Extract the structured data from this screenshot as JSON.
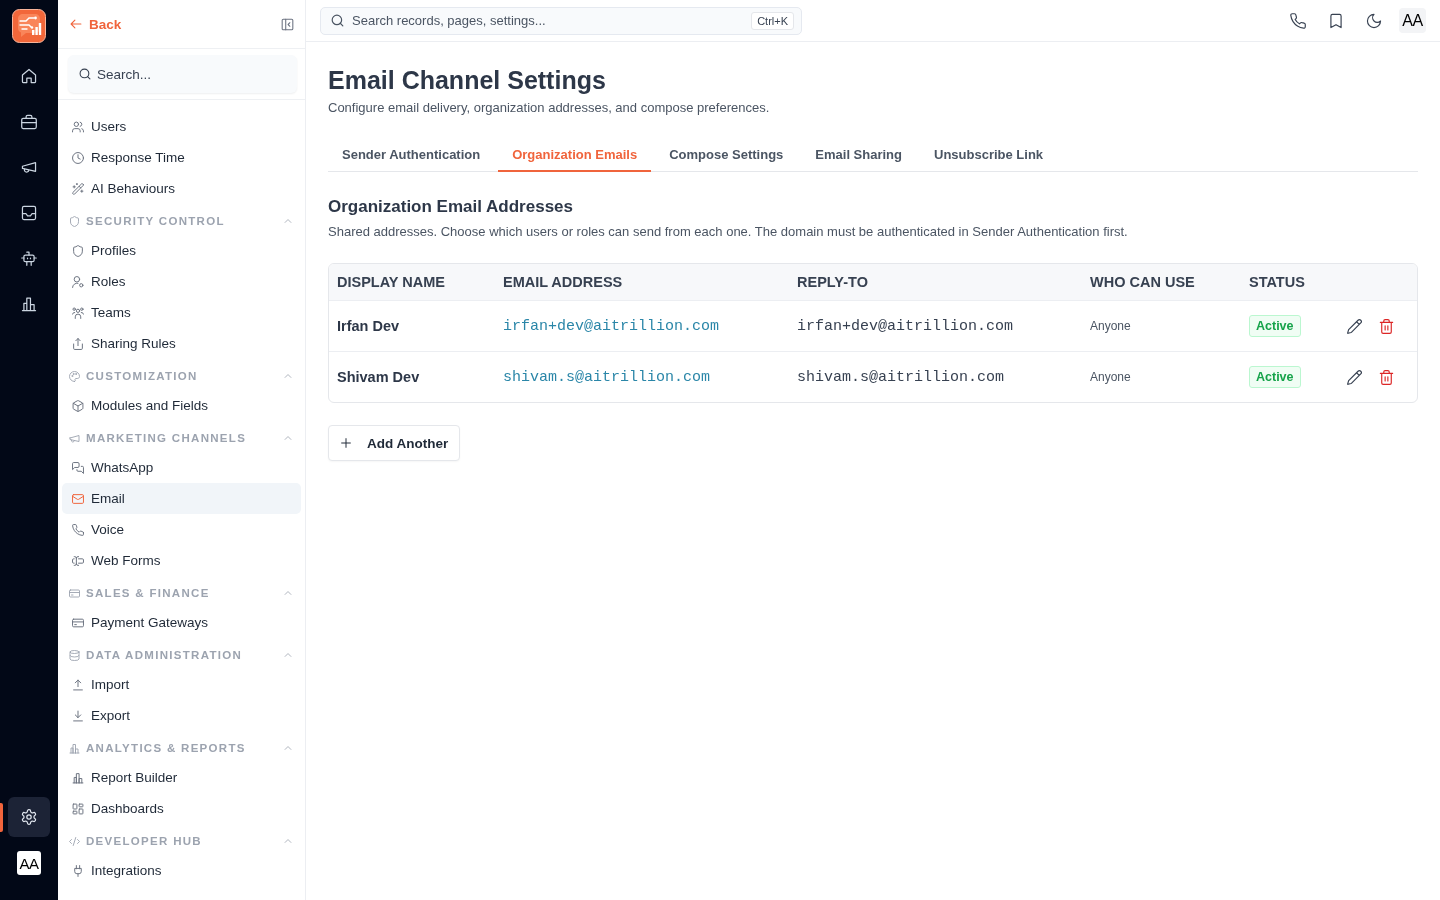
{
  "rail": {
    "nav_items": [
      {
        "selected": false
      },
      {
        "selected": false
      },
      {
        "selected": false
      },
      {
        "selected": false
      },
      {
        "selected": false
      },
      {
        "selected": false
      }
    ],
    "bottom_items": [
      {
        "selected": true
      }
    ],
    "avatar": "AA"
  },
  "sidebar": {
    "back_label": "Back",
    "search": {
      "placeholder": "Search..."
    },
    "items": [
      {
        "label": "Users",
        "selected": false
      },
      {
        "label": "Response Time",
        "selected": false
      },
      {
        "label": "AI Behaviours",
        "selected": false
      }
    ],
    "sections": [
      {
        "title": "SECURITY CONTROL",
        "expanded": true,
        "items": [
          {
            "label": "Profiles",
            "selected": false
          },
          {
            "label": "Roles",
            "selected": false
          },
          {
            "label": "Teams",
            "selected": false
          },
          {
            "label": "Sharing Rules",
            "selected": false
          }
        ]
      },
      {
        "title": "CUSTOMIZATION",
        "expanded": true,
        "items": [
          {
            "label": "Modules and Fields",
            "selected": false
          }
        ]
      },
      {
        "title": "MARKETING CHANNELS",
        "expanded": true,
        "items": [
          {
            "label": "WhatsApp",
            "selected": false
          },
          {
            "label": "Email",
            "selected": true
          },
          {
            "label": "Voice",
            "selected": false
          },
          {
            "label": "Web Forms",
            "selected": false
          }
        ]
      },
      {
        "title": "SALES & FINANCE",
        "expanded": true,
        "items": [
          {
            "label": "Payment Gateways",
            "selected": false
          }
        ]
      },
      {
        "title": "DATA ADMINISTRATION",
        "expanded": true,
        "items": [
          {
            "label": "Import",
            "selected": false
          },
          {
            "label": "Export",
            "selected": false
          }
        ]
      },
      {
        "title": "ANALYTICS & REPORTS",
        "expanded": true,
        "items": [
          {
            "label": "Report Builder",
            "selected": false
          },
          {
            "label": "Dashboards",
            "selected": false
          }
        ]
      },
      {
        "title": "DEVELOPER HUB",
        "expanded": true,
        "items": [
          {
            "label": "Integrations",
            "selected": false
          }
        ]
      }
    ]
  },
  "top_bar": {
    "search": {
      "placeholder": "Search records, pages, settings...",
      "shortcut": "Ctrl+K"
    },
    "avatar": "AA"
  },
  "page": {
    "title": "Email Channel Settings",
    "subtitle": "Configure email delivery, organization addresses, and compose preferences.",
    "tabs": [
      {
        "label": "Sender Authentication",
        "selected": false
      },
      {
        "label": "Organization Emails",
        "selected": true
      },
      {
        "label": "Compose Settings",
        "selected": false
      },
      {
        "label": "Email Sharing",
        "selected": false
      },
      {
        "label": "Unsubscribe Link",
        "selected": false
      }
    ],
    "section": {
      "title": "Organization Email Addresses",
      "description": "Shared addresses. Choose which users or roles can send from each one. The domain must be authenticated in Sender Authentication first."
    },
    "table": {
      "columns": [
        "DISPLAY NAME",
        "EMAIL ADDRESS",
        "REPLY-TO",
        "WHO CAN USE",
        "STATUS"
      ],
      "rows": [
        {
          "display_name": "Irfan Dev",
          "email": "irfan+dev@aitrillion.com",
          "reply_to": "irfan+dev@aitrillion.com",
          "who_can_use": "Anyone",
          "status": "Active",
          "active": true
        },
        {
          "display_name": "Shivam Dev",
          "email": "shivam.s@aitrillion.com",
          "reply_to": "shivam.s@aitrillion.com",
          "who_can_use": "Anyone",
          "status": "Active",
          "active": true
        }
      ]
    },
    "add_button": "Add Another"
  }
}
